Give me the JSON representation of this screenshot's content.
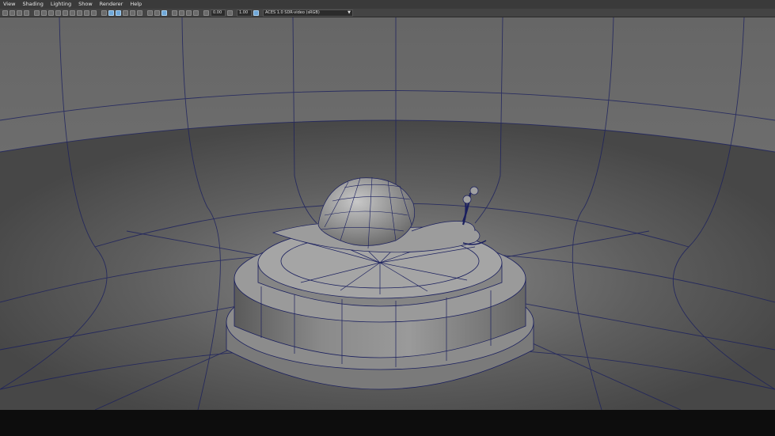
{
  "menu": {
    "items": [
      "View",
      "Shading",
      "Lighting",
      "Show",
      "Renderer",
      "Help"
    ]
  },
  "toolbar": {
    "exposure_value": "0.00",
    "gamma_value": "1.00",
    "color_space": "ACES 1.0 SDR-video (sRGB)",
    "accent_color": "#6fa7d8"
  },
  "viewport": {
    "background": "#6e6e6e",
    "wireframe_color": "#1a1f5e",
    "scene_objects": [
      "snail",
      "pedestal",
      "cyclorama"
    ]
  }
}
